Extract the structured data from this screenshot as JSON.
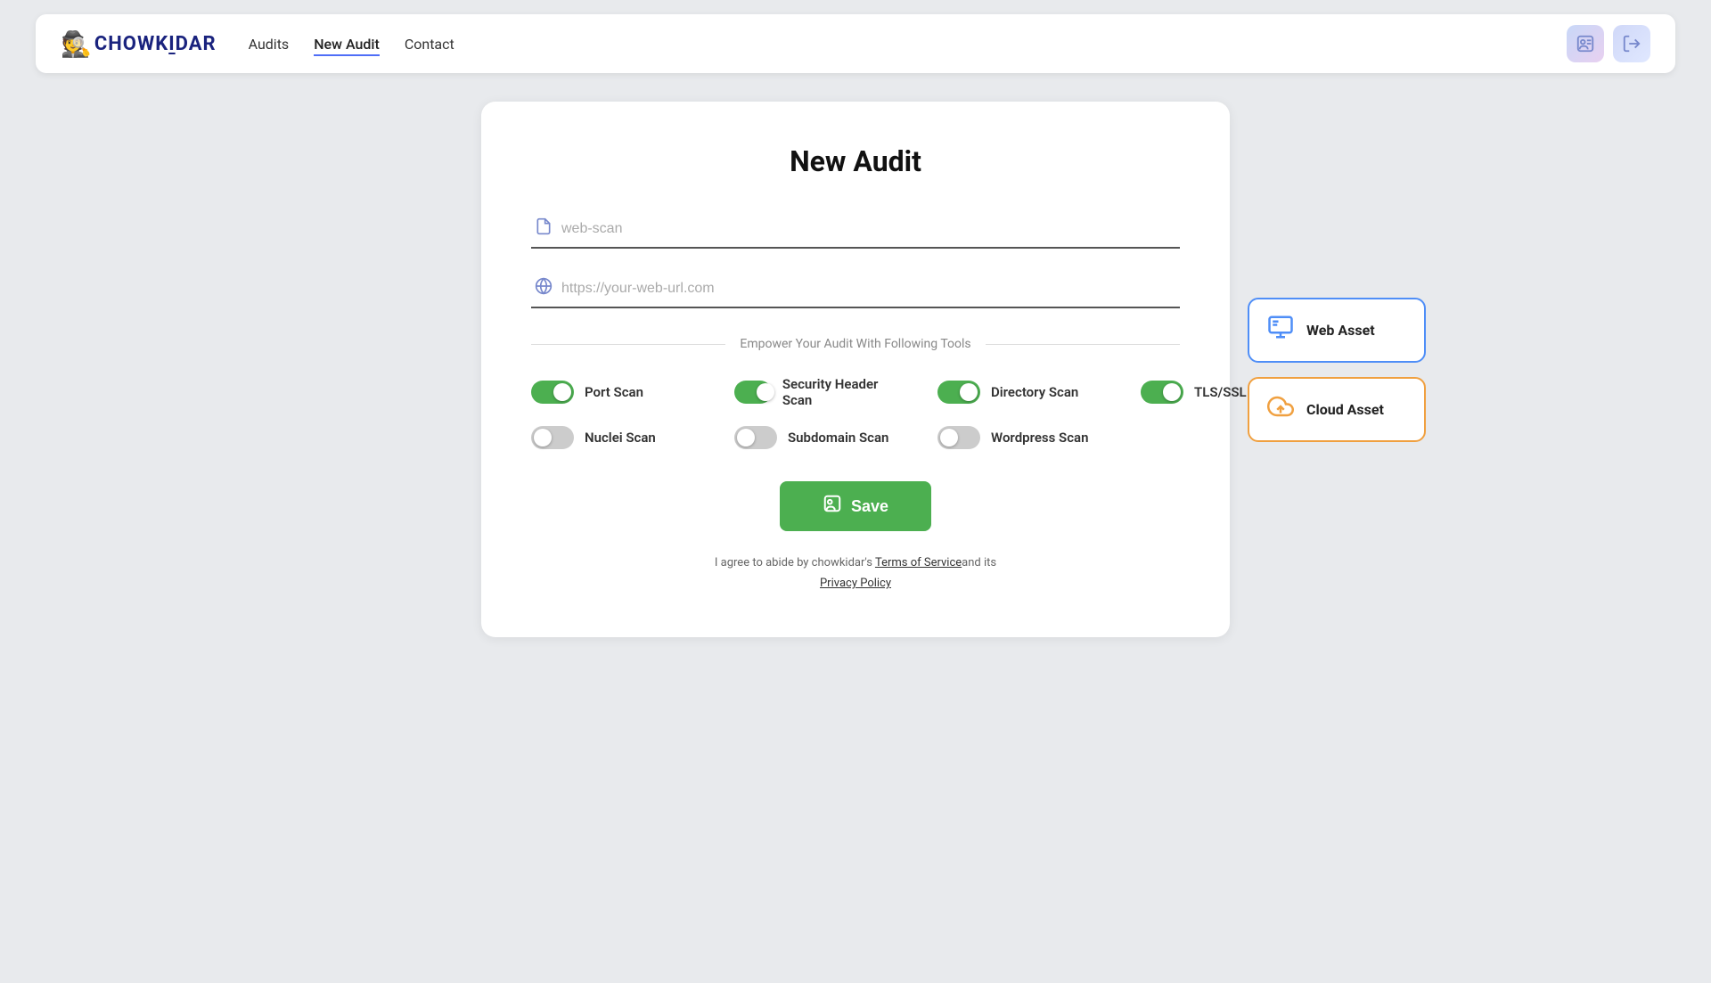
{
  "navbar": {
    "logo_text": "CHOWK|DAR",
    "logo_icon": "🕵",
    "links": [
      {
        "label": "Audits",
        "active": false
      },
      {
        "label": "New Audit",
        "active": true
      },
      {
        "label": "Contact",
        "active": false
      }
    ],
    "profile_icon": "👤",
    "logout_icon": "→"
  },
  "page": {
    "title": "New Audit",
    "name_placeholder": "web-scan",
    "url_placeholder": "https://your-web-url.com",
    "tools_section_label": "Empower Your Audit With Following Tools",
    "toggles": [
      {
        "label": "Port Scan",
        "on": true
      },
      {
        "label": "Security Header Scan",
        "on": true
      },
      {
        "label": "Directory Scan",
        "on": true
      },
      {
        "label": "TLS/SSL Scan",
        "on": true
      },
      {
        "label": "Nuclei Scan",
        "on": false
      },
      {
        "label": "Subdomain Scan",
        "on": false
      },
      {
        "label": "Wordpress Scan",
        "on": false
      }
    ],
    "save_button_label": "Save",
    "legal_text_before": "I agree to abide by chowkidar's ",
    "terms_label": "Terms of Service",
    "legal_text_middle": "and its",
    "privacy_label": "Privacy Policy"
  },
  "asset_cards": [
    {
      "label": "Web Asset",
      "type": "web",
      "icon": "🖥"
    },
    {
      "label": "Cloud Asset",
      "type": "cloud",
      "icon": "☁"
    }
  ]
}
